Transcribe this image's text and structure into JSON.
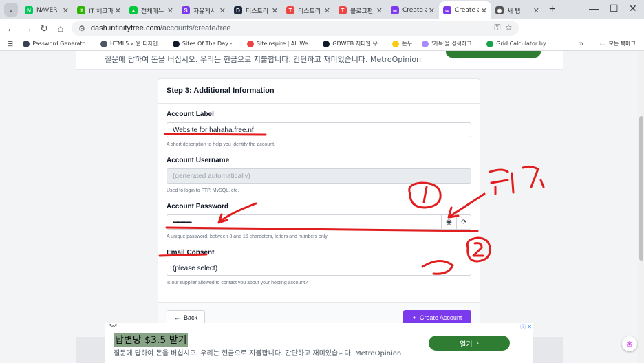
{
  "tabs": [
    {
      "title": "NAVER",
      "favicon": "naver-icon",
      "color": "#03c75a",
      "letter": "N"
    },
    {
      "title": "IT 체크파",
      "favicon": "it-icon",
      "color": "#2db400",
      "letter": "it"
    },
    {
      "title": "전체메뉴",
      "favicon": "menu-icon",
      "color": "#00c73c",
      "letter": "▲"
    },
    {
      "title": "자유게시",
      "favicon": "s-icon",
      "color": "#7c3aed",
      "letter": "S"
    },
    {
      "title": "티스토리",
      "favicon": "d-icon",
      "color": "#1e293b",
      "letter": "D"
    },
    {
      "title": "티스토리",
      "favicon": "tistory-icon",
      "color": "#ef4444",
      "letter": "T"
    },
    {
      "title": "블로그편",
      "favicon": "tistory-icon",
      "color": "#ef4444",
      "letter": "T"
    },
    {
      "title": "Create a",
      "favicon": "infinity-icon",
      "color": "#7c3aed",
      "letter": "∞"
    },
    {
      "title": "Create a",
      "favicon": "infinity-icon",
      "color": "#7c3aed",
      "letter": "∞"
    },
    {
      "title": "새 탭",
      "favicon": "chrome-icon",
      "color": "#555555",
      "letter": "◉"
    }
  ],
  "toolbar": {
    "url_host": "dash.infinityfree.com",
    "url_path": "/accounts/create/free",
    "ext_badge": "21"
  },
  "bookmarks": [
    {
      "label": "Password Generato...",
      "color": "#374151"
    },
    {
      "label": "HTML5 « 웹 디자인...",
      "color": "#4b5563"
    },
    {
      "label": "Sites Of The Day -...",
      "color": "#111827"
    },
    {
      "label": "Siteinspire | All We...",
      "color": "#ef4444"
    },
    {
      "label": "GDWEB:지디웹 우...",
      "color": "#111827"
    },
    {
      "label": "눈누",
      "color": "#facc15"
    },
    {
      "label": "'가독'을 검색하고...",
      "color": "#a78bfa"
    },
    {
      "label": "Grid Calculator by...",
      "color": "#16a34a"
    }
  ],
  "bookmarks_folder": "모든 북마크",
  "top_ad": {
    "text": "질문에 답하여 돈을 버십시오. 우리는 현금으로 지불합니다. 간단하고 재미있습니다. MetroOpinion"
  },
  "form": {
    "step_title": "Step 3: Additional Information",
    "label_field": {
      "label": "Account Label",
      "value": "Website for hahaha.free.nf",
      "help": "A short description to help you identify the account."
    },
    "username_field": {
      "label": "Account Username",
      "placeholder": "(generated automatically)",
      "help": "Used to login to FTP, MySQL, etc."
    },
    "password_field": {
      "label": "Account Password",
      "value": "•••••••••••••••",
      "help": "A unique password, between 8 and 15 characters, letters and numbers only."
    },
    "email_field": {
      "label": "Email Consent",
      "value": "(please select)",
      "help": "Is our supplier allowed to contact you about your hosting account?"
    },
    "back_label": "Back",
    "create_label": "Create Account"
  },
  "bottom_ad": {
    "headline": "답변당 $3.5 받기",
    "sub": "질문에 답하여 돈을 버십시오. 우리는 현금으로 지불합니다. 간단하고 재미있습니다. MetroOpinion",
    "open_label": "열기"
  },
  "annotations": {
    "click_text": "클릭",
    "colors": {
      "ink": "#e11d1d"
    }
  }
}
